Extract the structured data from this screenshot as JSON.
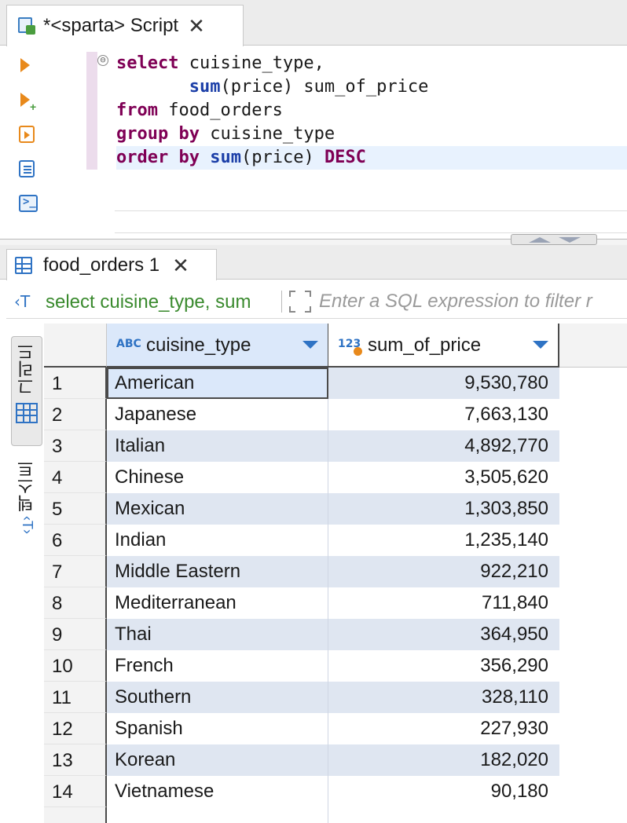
{
  "editor_tab": {
    "title": "*<sparta> Script",
    "close": "✕"
  },
  "editor": {
    "lines": [
      [
        {
          "t": "select",
          "c": "kw"
        },
        {
          "t": " cuisine_type,",
          "c": "tx"
        }
      ],
      [
        {
          "t": "       ",
          "c": "tx"
        },
        {
          "t": "sum",
          "c": "fn"
        },
        {
          "t": "(price) sum_of_price",
          "c": "tx"
        }
      ],
      [
        {
          "t": "from",
          "c": "kw"
        },
        {
          "t": " food_orders",
          "c": "tx"
        }
      ],
      [
        {
          "t": "group by",
          "c": "kw"
        },
        {
          "t": " cuisine_type",
          "c": "tx"
        }
      ],
      [
        {
          "t": "order by",
          "c": "kw"
        },
        {
          "t": " ",
          "c": "tx"
        },
        {
          "t": "sum",
          "c": "fn"
        },
        {
          "t": "(price) ",
          "c": "tx"
        },
        {
          "t": "DESC",
          "c": "kw"
        }
      ]
    ],
    "fold_marker": "⊖"
  },
  "result_tab": {
    "title": "food_orders 1",
    "close": "✕"
  },
  "filter": {
    "query_icon": "‹T",
    "query_text": "select cuisine_type, sum",
    "placeholder": "Enter a SQL expression to filter r"
  },
  "side_tabs": {
    "grid_label": "그리드",
    "text_label": "텍스트"
  },
  "grid": {
    "columns": [
      {
        "type_icon": "ABC",
        "label": "cuisine_type"
      },
      {
        "type_icon": "123",
        "label": "sum_of_price"
      }
    ],
    "rows": [
      {
        "num": "1",
        "cuisine_type": "American",
        "sum_of_price": "9,530,780"
      },
      {
        "num": "2",
        "cuisine_type": "Japanese",
        "sum_of_price": "7,663,130"
      },
      {
        "num": "3",
        "cuisine_type": "Italian",
        "sum_of_price": "4,892,770"
      },
      {
        "num": "4",
        "cuisine_type": "Chinese",
        "sum_of_price": "3,505,620"
      },
      {
        "num": "5",
        "cuisine_type": "Mexican",
        "sum_of_price": "1,303,850"
      },
      {
        "num": "6",
        "cuisine_type": "Indian",
        "sum_of_price": "1,235,140"
      },
      {
        "num": "7",
        "cuisine_type": "Middle Eastern",
        "sum_of_price": "922,210"
      },
      {
        "num": "8",
        "cuisine_type": "Mediterranean",
        "sum_of_price": "711,840"
      },
      {
        "num": "9",
        "cuisine_type": "Thai",
        "sum_of_price": "364,950"
      },
      {
        "num": "10",
        "cuisine_type": "French",
        "sum_of_price": "356,290"
      },
      {
        "num": "11",
        "cuisine_type": "Southern",
        "sum_of_price": "328,110"
      },
      {
        "num": "12",
        "cuisine_type": "Spanish",
        "sum_of_price": "227,930"
      },
      {
        "num": "13",
        "cuisine_type": "Korean",
        "sum_of_price": "182,020"
      },
      {
        "num": "14",
        "cuisine_type": "Vietnamese",
        "sum_of_price": "90,180"
      }
    ]
  },
  "colors": {
    "keyword": "#7f0055",
    "function": "#1c3fa8",
    "accent": "#2f73c4",
    "row_alt": "#dfe6f1",
    "header_selected": "#dbe8fa",
    "filter_query": "#3a8a2e"
  }
}
